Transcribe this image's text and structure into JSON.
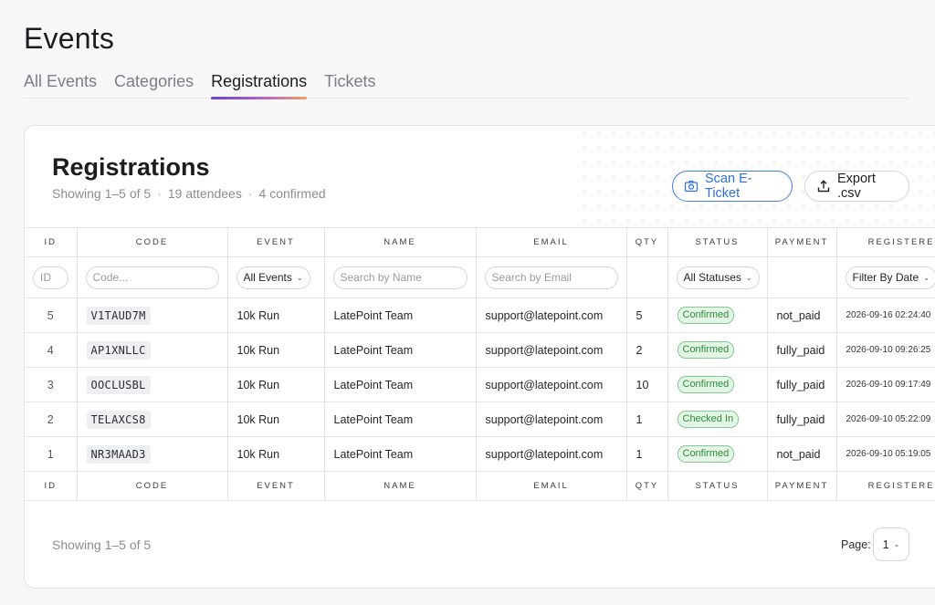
{
  "page": {
    "title": "Events"
  },
  "tabs": [
    {
      "label": "All Events",
      "active": false
    },
    {
      "label": "Categories",
      "active": false
    },
    {
      "label": "Registrations",
      "active": true
    },
    {
      "label": "Tickets",
      "active": false
    }
  ],
  "card": {
    "title": "Registrations",
    "showing": "Showing 1–5 of 5",
    "attendees": "19 attendees",
    "confirmed": "4 confirmed",
    "sep": "·",
    "scan_label": "Scan E-Ticket",
    "export_label": "Export .csv"
  },
  "table": {
    "columns": [
      "ID",
      "CODE",
      "EVENT",
      "NAME",
      "EMAIL",
      "QTY",
      "STATUS",
      "PAYMENT",
      "REGISTERED"
    ],
    "filters": {
      "id_placeholder": "ID",
      "code_placeholder": "Code...",
      "event_select": "All Events",
      "name_placeholder": "Search by Name",
      "email_placeholder": "Search by Email",
      "status_select": "All Statuses",
      "date_select": "Filter By Date"
    },
    "rows": [
      {
        "id": "5",
        "code": "V1TAUD7M",
        "event": "10k Run",
        "name": "LatePoint Team",
        "email": "support@latepoint.com",
        "qty": "5",
        "status": "Confirmed",
        "payment": "not_paid",
        "registered": "2026-09-16 02:24:40"
      },
      {
        "id": "4",
        "code": "AP1XNLLC",
        "event": "10k Run",
        "name": "LatePoint Team",
        "email": "support@latepoint.com",
        "qty": "2",
        "status": "Confirmed",
        "payment": "fully_paid",
        "registered": "2026-09-10 09:26:25"
      },
      {
        "id": "3",
        "code": "OOCLUSBL",
        "event": "10k Run",
        "name": "LatePoint Team",
        "email": "support@latepoint.com",
        "qty": "10",
        "status": "Confirmed",
        "payment": "fully_paid",
        "registered": "2026-09-10 09:17:49"
      },
      {
        "id": "2",
        "code": "TELAXCS8",
        "event": "10k Run",
        "name": "LatePoint Team",
        "email": "support@latepoint.com",
        "qty": "1",
        "status": "Checked In",
        "payment": "fully_paid",
        "registered": "2026-09-10 05:22:09"
      },
      {
        "id": "1",
        "code": "NR3MAAD3",
        "event": "10k Run",
        "name": "LatePoint Team",
        "email": "support@latepoint.com",
        "qty": "1",
        "status": "Confirmed",
        "payment": "not_paid",
        "registered": "2026-09-10 05:19:05"
      }
    ]
  },
  "footer": {
    "showing": "Showing 1–5 of 5",
    "page_label": "Page:",
    "page_value": "1"
  },
  "icons": {
    "scan": "camera-icon",
    "export": "upload-icon",
    "chevron": "chevron-down-icon"
  },
  "colors": {
    "accent": "#2f6fde",
    "badge_bg": "#e3f6e5",
    "badge_text": "#2f8a3b",
    "tab_gradient_start": "#6d3fd6",
    "tab_gradient_end": "#f0a062"
  }
}
